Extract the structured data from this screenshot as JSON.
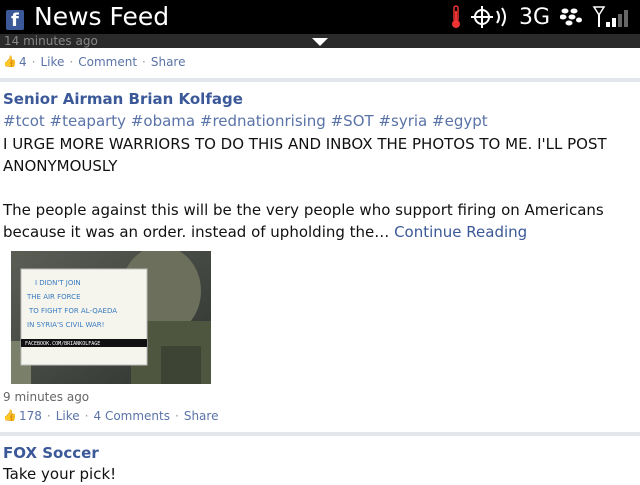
{
  "status_bar": {
    "app_title": "News Feed",
    "network": "3G",
    "icons": [
      "facebook-icon",
      "thermometer-icon",
      "gps-icon",
      "signal-icon",
      "blackberry-icon",
      "signal-bars-icon"
    ]
  },
  "feed": {
    "posts": [
      {
        "timestamp": "14 minutes ago",
        "likes_count": "4",
        "like_label": "Like",
        "comment_label": "Comment",
        "share_label": "Share"
      },
      {
        "author": "Senior Airman Brian Kolfage",
        "tags": [
          "#tcot",
          "#teaparty",
          "#obama",
          "#rednationrising",
          "#SOT",
          "#syria",
          "#egypt"
        ],
        "paragraph1": "I URGE MORE WARRIORS TO DO THIS AND INBOX THE PHOTOS TO ME. I'LL POST ANONYMOUSLY",
        "paragraph2": "The people against this will be the very people who support firing on Americans because it was an order. instead of upholding the…",
        "continue_label": "Continue Reading",
        "photo_caption": "I DIDN'T JOIN THE AIR FORCE TO FIGHT FOR AL-QAEDA IN SYRIA'S CIVIL WAR!",
        "photo_url_text": "FACEBOOK.COM/BRIANKOLFAGE",
        "timestamp": "9 minutes ago",
        "likes_count": "178",
        "like_label": "Like",
        "comment_label": "4 Comments",
        "share_label": "Share"
      },
      {
        "author": "FOX Soccer",
        "text": "Take your pick!"
      }
    ]
  },
  "colors": {
    "link": "#3b5998",
    "action": "#5a73a8",
    "status_bar": "#000000"
  }
}
